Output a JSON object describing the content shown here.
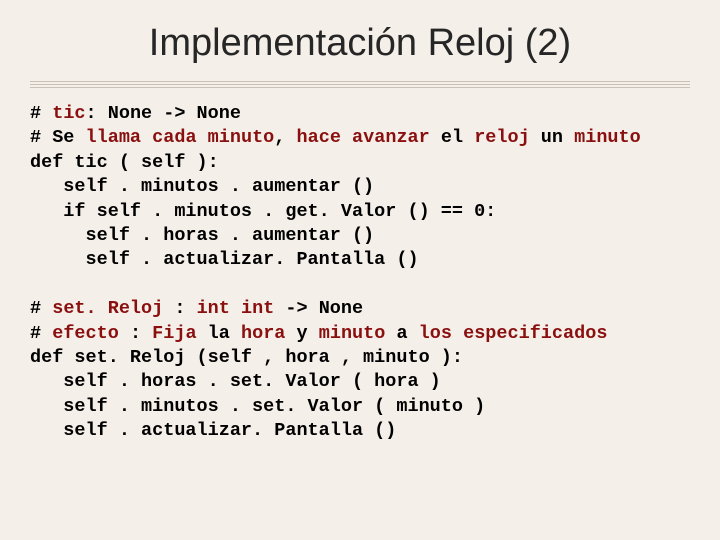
{
  "title": "Implementación Reloj (2)",
  "code": {
    "l01a": "# ",
    "l01b": "tic",
    "l01c": ": None -> None",
    "l02a": "# Se ",
    "l02b": "llama",
    "l02c": " ",
    "l02d": "cada",
    "l02e": " ",
    "l02f": "minuto",
    "l02g": ", ",
    "l02h": "hace",
    "l02i": " ",
    "l02j": "avanzar",
    "l02k": " el ",
    "l02l": "reloj",
    "l02m": " un ",
    "l02n": "minuto",
    "l03": "def tic ( self ):",
    "l04": "   self . minutos . aumentar ()",
    "l05": "   if self . minutos . get. Valor () == 0:",
    "l06": "     self . horas . aumentar ()",
    "l07": "     self . actualizar. Pantalla ()",
    "l08a": "# ",
    "l08b": "set. Reloj",
    "l08c": " : ",
    "l08d": "int int",
    "l08e": " -> None",
    "l09a": "# ",
    "l09b": "efecto",
    "l09c": " : ",
    "l09d": "Fija",
    "l09e": " la ",
    "l09f": "hora",
    "l09g": " y ",
    "l09h": "minuto",
    "l09i": " a ",
    "l09j": "los",
    "l09k": " ",
    "l09l": "especificados",
    "l10": "def set. Reloj (self , hora , minuto ):",
    "l11": "   self . horas . set. Valor ( hora )",
    "l12": "   self . minutos . set. Valor ( minuto )",
    "l13": "   self . actualizar. Pantalla ()"
  }
}
